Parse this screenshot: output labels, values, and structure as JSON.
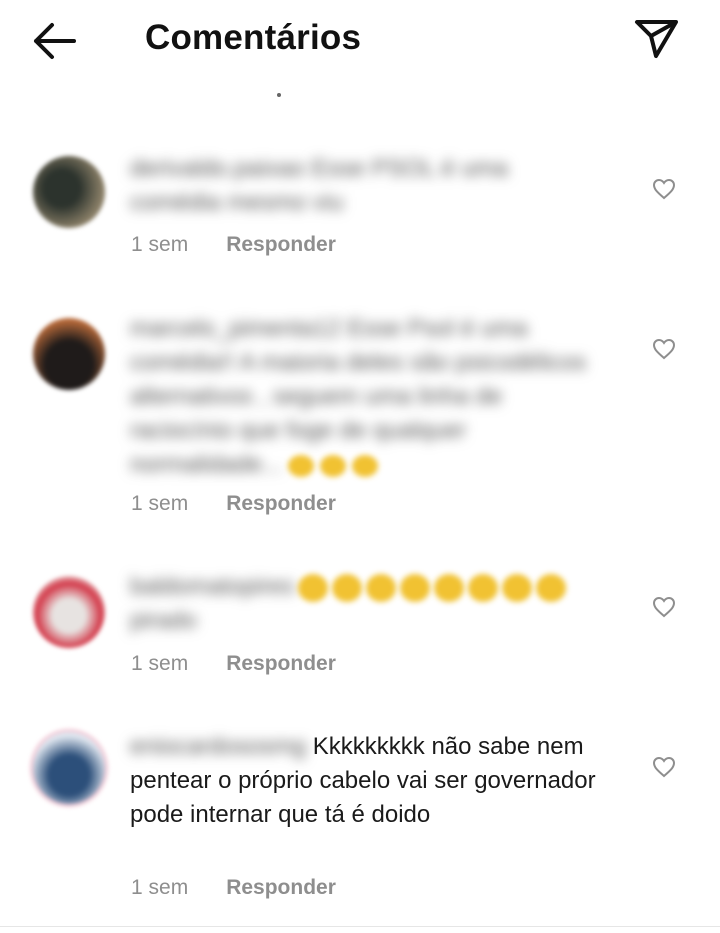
{
  "header": {
    "title": "Comentários",
    "back_icon": "arrow-left-icon",
    "send_icon": "paper-plane-icon"
  },
  "comments": [
    {
      "username": "derivaldo.paixao",
      "text": "Esse PSOL é uma comédia mesmo viu",
      "time": "1 sem",
      "reply": "Responder",
      "avatar_colors": [
        "#3a3f3a",
        "#8b8068"
      ]
    },
    {
      "username": "marcelo_pimenta12",
      "text": "Esse Psol é uma comédia!! A maioria deles são psicodélicos alternativos , seguem uma linha de raciocínio que foge de qualquer normalidade...",
      "time": "1 sem",
      "reply": "Responder",
      "avatar_colors": [
        "#1f1b1a",
        "#b86a3a"
      ]
    },
    {
      "username": "baldomatopires",
      "text": "pirado",
      "time": "1 sem",
      "reply": "Responder",
      "avatar_colors": [
        "#d33a4a",
        "#e7e3e1"
      ]
    },
    {
      "username": "eniocardososmg",
      "text": "Kkkkkkkkk não sabe nem pentear o próprio cabelo vai ser governador pode internar que tá é doido",
      "time": "1 sem",
      "reply": "Responder",
      "avatar_colors": [
        "#2c4f7a",
        "#dfe6ef"
      ]
    }
  ],
  "colors": {
    "meta_text": "#8e8e8e",
    "emoji": "#f1c232"
  }
}
